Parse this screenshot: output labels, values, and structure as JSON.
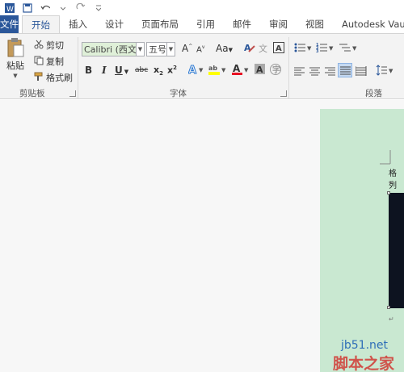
{
  "tabs": [
    "文件",
    "开始",
    "插入",
    "设计",
    "页面布局",
    "引用",
    "邮件",
    "审阅",
    "视图",
    "Autodesk Vau"
  ],
  "clipboard": {
    "paste": "粘贴",
    "cut": "剪切",
    "copy": "复制",
    "format_painter": "格式刷",
    "label": "剪贴板"
  },
  "font": {
    "name": "Calibri (西文)",
    "size": "五号",
    "label": "字体"
  },
  "paragraph": {
    "label": "段落"
  },
  "document": {
    "text": "格列"
  },
  "watermark": {
    "line1": "jb51.net",
    "line2": "脚本之家"
  },
  "colors": {
    "accent": "#2b579a",
    "page": "#c9e8d1",
    "highlight": "#ffff00",
    "font_color": "#e81123"
  }
}
